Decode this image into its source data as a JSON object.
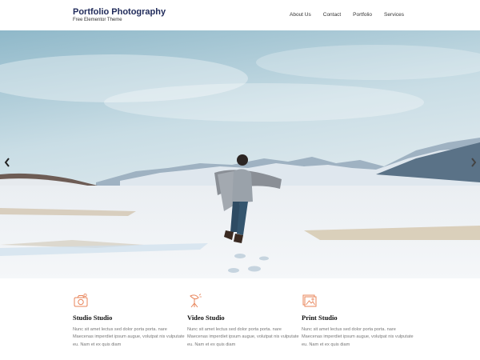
{
  "site": {
    "title": "Portfolio Photography",
    "tagline": "Free Elementor Theme"
  },
  "nav": {
    "items": [
      "About Us",
      "Contact",
      "Portfolio",
      "Services"
    ]
  },
  "slider": {
    "prev_icon": "chevron-left-icon",
    "next_icon": "chevron-right-icon"
  },
  "services": [
    {
      "icon": "camera-icon",
      "title": "Studio Studio",
      "text": "Nunc sit amet lectus sed dolor porta porta. nare Maecenas imperdiet ipsum augue, volutpat nis vulputate eu. Nam et ex quis diam"
    },
    {
      "icon": "studio-light-icon",
      "title": "Video Studio",
      "text": "Nunc sit amet lectus sed dolor porta porta. nare Maecenas imperdiet ipsum augue, volutpat nis vulputate eu. Nam et ex quis diam"
    },
    {
      "icon": "photos-icon",
      "title": "Print Studio",
      "text": "Nunc sit amet lectus sed dolor porta porta. nare Maecenas imperdiet ipsum augue, volutpat nis vulputate eu. Nam et ex quis diam"
    }
  ],
  "colors": {
    "brand": "#1f2a5a",
    "accent": "#e8845a"
  }
}
